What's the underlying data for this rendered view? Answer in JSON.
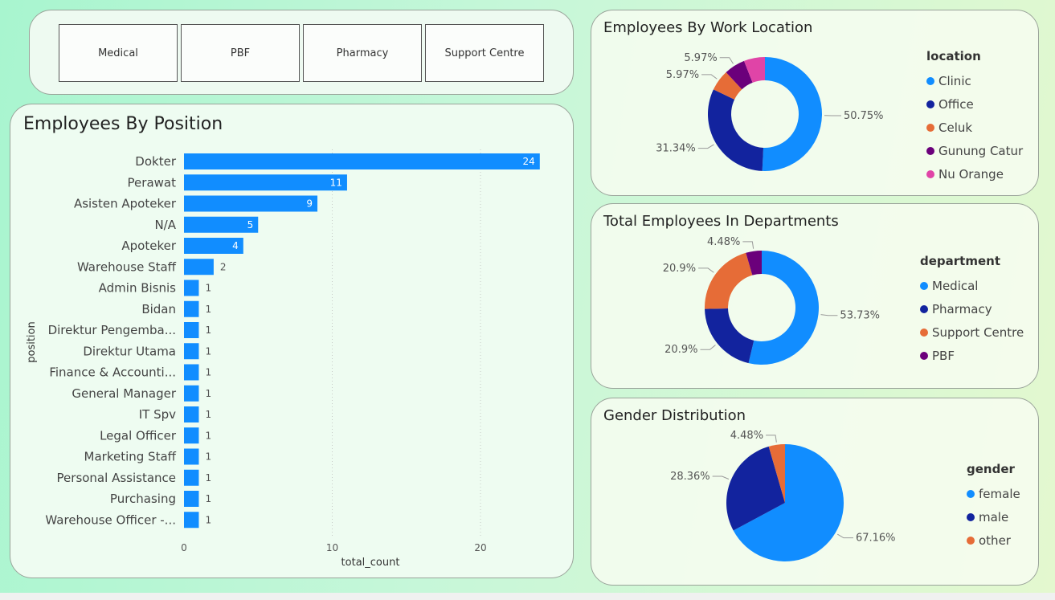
{
  "slicer": {
    "buttons": [
      "Medical",
      "PBF",
      "Pharmacy",
      "Support Centre"
    ]
  },
  "chart_data": [
    {
      "type": "bar",
      "orientation": "horizontal",
      "title": "Employees By Position",
      "xlabel": "total_count",
      "ylabel": "position",
      "categories": [
        "Dokter",
        "Perawat",
        "Asisten Apoteker",
        "N/A",
        "Apoteker",
        "Warehouse Staff",
        "Admin Bisnis",
        "Bidan",
        "Direktur Pengemba...",
        "Direktur Utama",
        "Finance & Accounti...",
        "General Manager",
        "IT Spv",
        "Legal Officer",
        "Marketing Staff",
        "Personal Assistance",
        "Purchasing",
        "Warehouse Officer -..."
      ],
      "values": [
        24,
        11,
        9,
        5,
        4,
        2,
        1,
        1,
        1,
        1,
        1,
        1,
        1,
        1,
        1,
        1,
        1,
        1
      ],
      "xticks": [
        0,
        10,
        20
      ],
      "xlim": [
        0,
        24.5
      ],
      "grid": true,
      "color": "#118DFF"
    },
    {
      "type": "pie",
      "donut": true,
      "title": "Employees By Work Location",
      "legend_title": "location",
      "legend_position": "right",
      "labels": [
        "Clinic",
        "Office",
        "Celuk",
        "Gunung Catur",
        "Nu Orange"
      ],
      "values": [
        50.75,
        31.34,
        5.97,
        5.97,
        5.97
      ],
      "value_labels": [
        "50.75%",
        "31.34%",
        "5.97%",
        "5.97%",
        ""
      ],
      "colors": [
        "#118DFF",
        "#12239E",
        "#E66C37",
        "#6B007B",
        "#E044A7"
      ]
    },
    {
      "type": "pie",
      "donut": true,
      "title": "Total Employees In Departments",
      "legend_title": "department",
      "legend_position": "right",
      "labels": [
        "Medical",
        "Pharmacy",
        "Support Centre",
        "PBF"
      ],
      "values": [
        53.73,
        20.9,
        20.9,
        4.48
      ],
      "value_labels": [
        "53.73%",
        "20.9%",
        "20.9%",
        "4.48%"
      ],
      "colors": [
        "#118DFF",
        "#12239E",
        "#E66C37",
        "#6B007B"
      ]
    },
    {
      "type": "pie",
      "donut": false,
      "title": "Gender Distribution",
      "legend_title": "gender",
      "legend_position": "right",
      "labels": [
        "female",
        "male",
        "other"
      ],
      "values": [
        67.16,
        28.36,
        4.48
      ],
      "value_labels": [
        "67.16%",
        "28.36%",
        "4.48%"
      ],
      "colors": [
        "#118DFF",
        "#12239E",
        "#E66C37"
      ]
    }
  ]
}
